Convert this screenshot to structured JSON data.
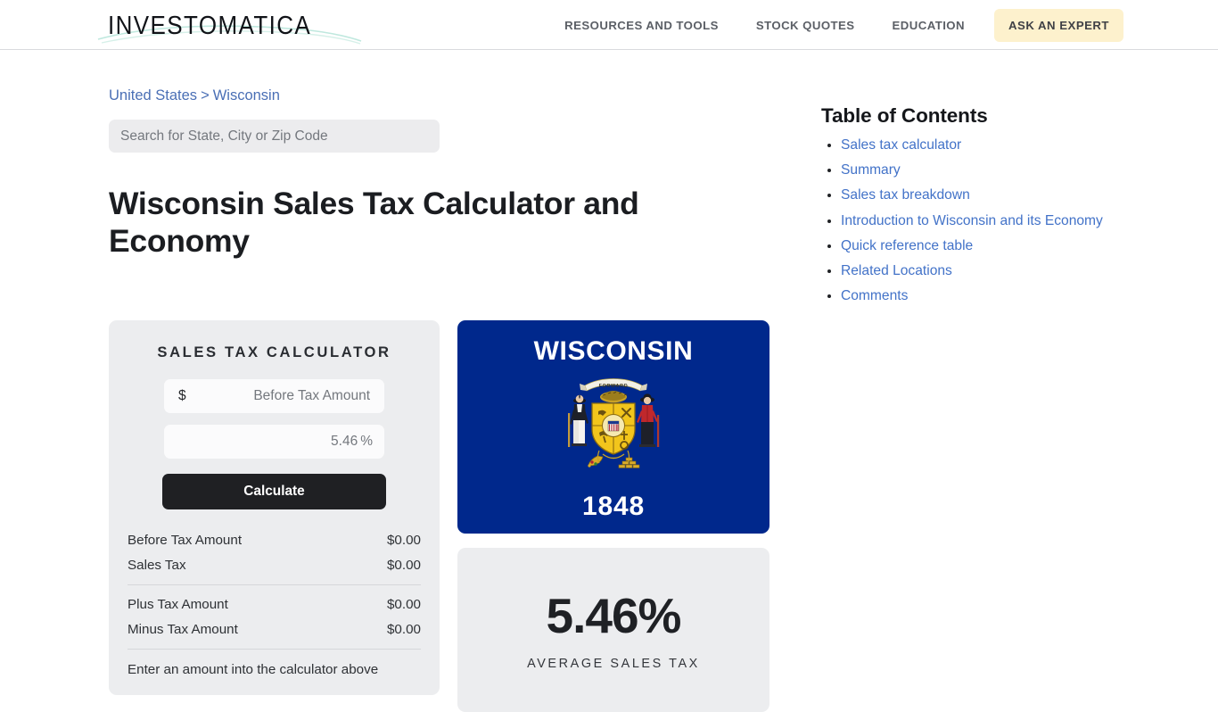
{
  "header": {
    "logo_text": "INVESTOMATICA",
    "logo_icon": "investomatica-wordmark",
    "nav": [
      {
        "label": "RESOURCES AND TOOLS",
        "name": "nav-resources-and-tools"
      },
      {
        "label": "STOCK QUOTES",
        "name": "nav-stock-quotes"
      },
      {
        "label": "EDUCATION",
        "name": "nav-education"
      }
    ],
    "cta_label": "ASK AN EXPERT",
    "cta_bg": "#fdf1cd"
  },
  "breadcrumb": {
    "country": "United States",
    "separator": ">",
    "state": "Wisconsin"
  },
  "search": {
    "value": "",
    "placeholder": "Search for State, City or Zip Code"
  },
  "main": {
    "page_title": "Wisconsin Sales Tax Calculator and Economy"
  },
  "toc": {
    "heading": "Table of Contents",
    "items": [
      {
        "label": "Sales tax calculator"
      },
      {
        "label": "Summary"
      },
      {
        "label": "Sales tax breakdown"
      },
      {
        "label": "Introduction to Wisconsin and its Economy"
      },
      {
        "label": "Quick reference table"
      },
      {
        "label": "Related Locations"
      },
      {
        "label": "Comments"
      }
    ],
    "link_color": "#4272c8"
  },
  "calculator": {
    "title": "SALES TAX CALCULATOR",
    "amount_prefix": "$",
    "amount_value": "",
    "amount_placeholder": "Before Tax Amount",
    "rate_value": "5.46",
    "rate_unit": "%",
    "button_label": "Calculate",
    "results": [
      {
        "label": "Before Tax Amount",
        "amount": "$0.00"
      },
      {
        "label": "Sales Tax",
        "amount": "$0.00"
      },
      {
        "label": "Plus Tax Amount",
        "amount": "$0.00"
      },
      {
        "label": "Minus Tax Amount",
        "amount": "$0.00"
      }
    ],
    "note": "Enter an amount into the calculator above"
  },
  "flag": {
    "state_name": "WISCONSIN",
    "year": "1848",
    "motto": "FORWARD",
    "blue": "#00288c",
    "alt": "wisconsin-state-flag"
  },
  "average_tax": {
    "value": "5.46%",
    "label": "AVERAGE SALES TAX"
  }
}
